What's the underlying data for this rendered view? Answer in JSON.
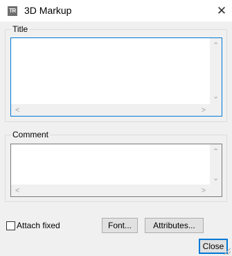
{
  "window": {
    "title": "3D Markup",
    "app_icon_text": "TR",
    "close_glyph": "✕"
  },
  "title_group": {
    "label": "Title",
    "value": ""
  },
  "comment_group": {
    "label": "Comment",
    "value": ""
  },
  "attach_fixed": {
    "label": "Attach fixed",
    "checked": false
  },
  "buttons": {
    "font": "Font...",
    "attributes": "Attributes...",
    "close": "Close"
  },
  "scroll_arrows": {
    "up": "⌃",
    "down": "⌄",
    "left": "<",
    "right": ">"
  }
}
